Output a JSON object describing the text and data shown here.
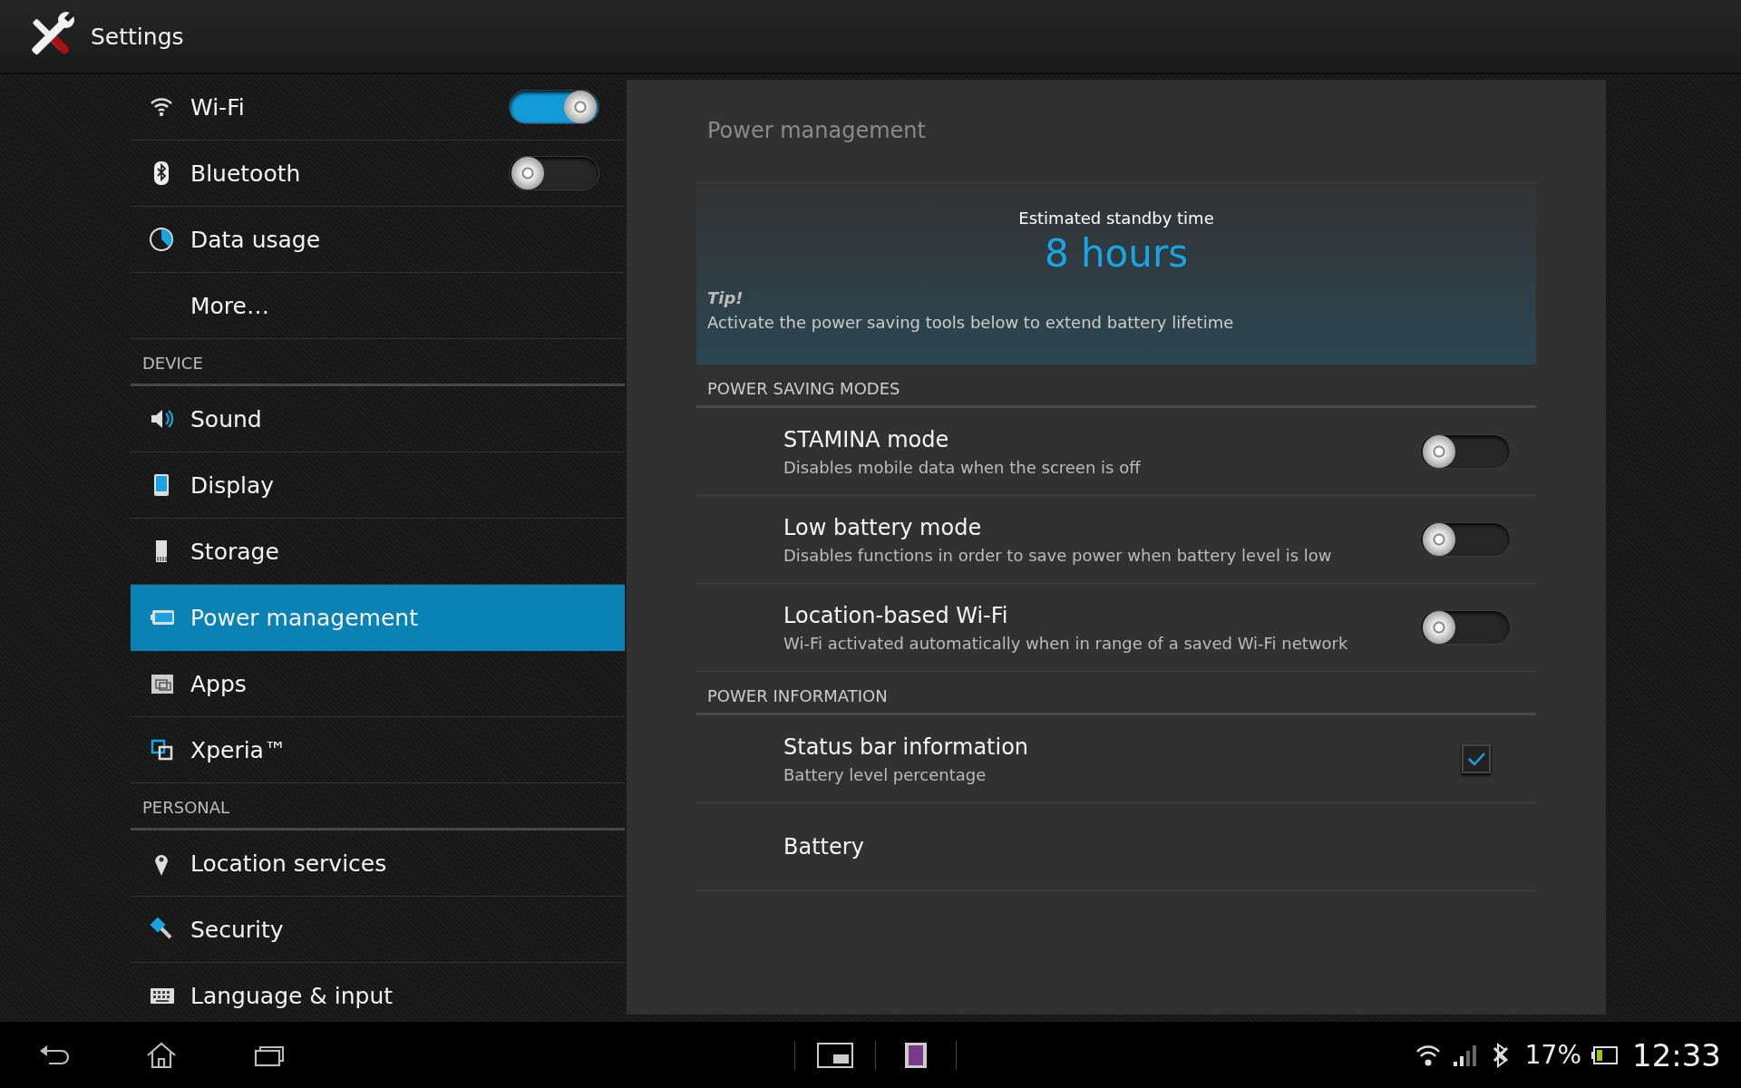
{
  "window": {
    "title": "Settings"
  },
  "sidebar": {
    "groups": [
      {
        "items": [
          {
            "label": "Wi-Fi",
            "selected": false,
            "kind": "toggle",
            "on": true
          },
          {
            "label": "Bluetooth",
            "selected": false,
            "kind": "toggle",
            "on": false
          },
          {
            "label": "Data usage",
            "selected": false,
            "kind": "link"
          },
          {
            "label": "More…",
            "selected": false,
            "kind": "link"
          }
        ]
      },
      {
        "title": "DEVICE",
        "items": [
          {
            "label": "Sound",
            "selected": false,
            "kind": "link"
          },
          {
            "label": "Display",
            "selected": false,
            "kind": "link"
          },
          {
            "label": "Storage",
            "selected": false,
            "kind": "link"
          },
          {
            "label": "Power management",
            "selected": true,
            "kind": "link"
          },
          {
            "label": "Apps",
            "selected": false,
            "kind": "link"
          },
          {
            "label": "Xperia™",
            "selected": false,
            "kind": "link"
          }
        ]
      },
      {
        "title": "PERSONAL",
        "items": [
          {
            "label": "Location services",
            "selected": false,
            "kind": "link"
          },
          {
            "label": "Security",
            "selected": false,
            "kind": "link"
          },
          {
            "label": "Language & input",
            "selected": false,
            "kind": "link"
          }
        ]
      }
    ]
  },
  "panel": {
    "title": "Power management",
    "standby": {
      "label": "Estimated standby time",
      "value": "8 hours",
      "tip_title": "Tip!",
      "tip_text": "Activate the power saving tools below to extend battery lifetime"
    },
    "sections": [
      {
        "title": "POWER SAVING MODES",
        "rows": [
          {
            "kind": "switch",
            "title": "STAMINA mode",
            "summary": "Disables mobile data when the screen is off",
            "on": false
          },
          {
            "kind": "switch",
            "title": "Low battery mode",
            "summary": "Disables functions in order to save power when battery level is low",
            "on": false
          },
          {
            "kind": "switch",
            "title": "Location-based Wi-Fi",
            "summary": "Wi-Fi activated automatically when in range of a saved Wi-Fi network",
            "on": false
          }
        ]
      },
      {
        "title": "POWER INFORMATION",
        "rows": [
          {
            "kind": "checkbox",
            "title": "Status bar information",
            "summary": "Battery level percentage",
            "checked": true
          },
          {
            "kind": "plain",
            "title": "Battery"
          }
        ]
      }
    ]
  },
  "status_bar": {
    "battery": "17%",
    "time": "12:33"
  }
}
